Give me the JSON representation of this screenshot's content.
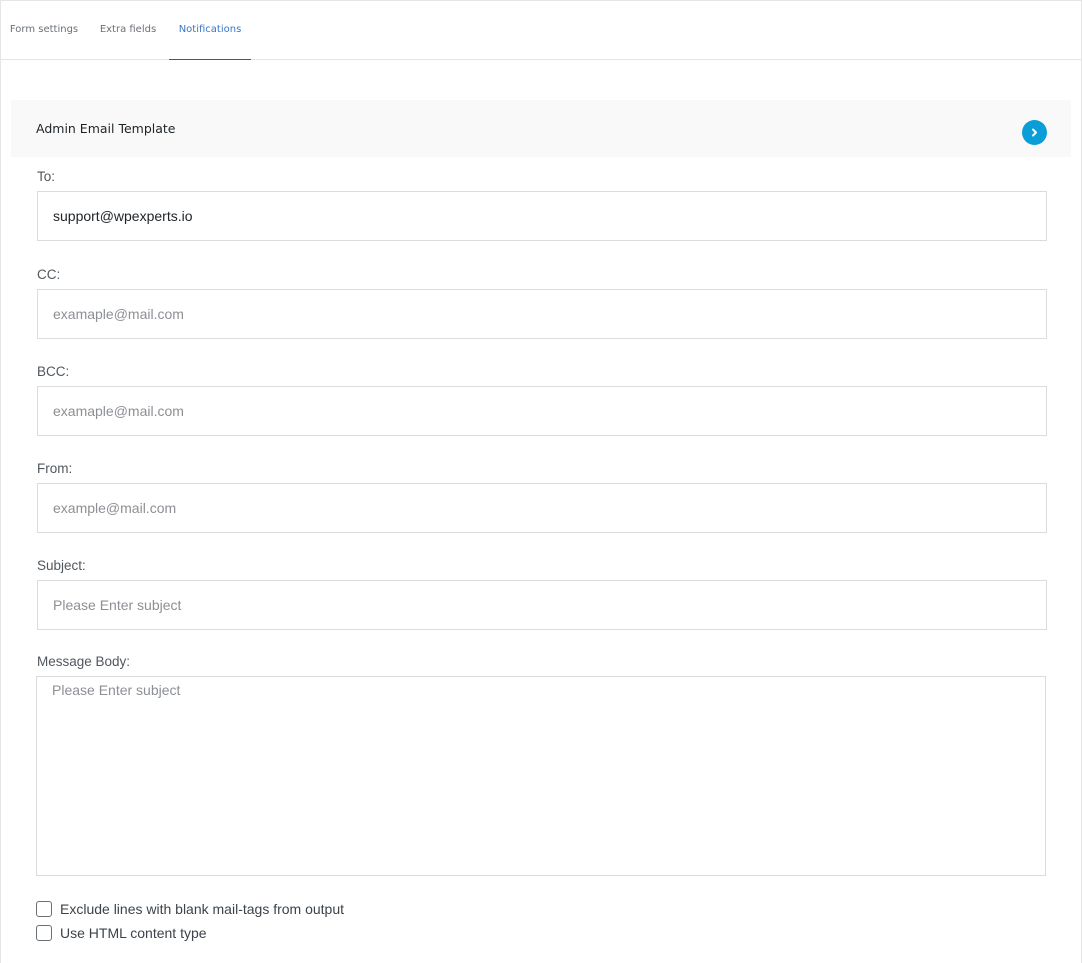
{
  "tabs": [
    {
      "label": "Form settings",
      "active": false
    },
    {
      "label": "Extra fields",
      "active": false
    },
    {
      "label": "Notifications",
      "active": true
    }
  ],
  "template": {
    "title": "Admin Email Template",
    "toggle_icon": "chevron-right-icon",
    "accent_color": "#0a9ed9"
  },
  "fields": {
    "to": {
      "label": "To:",
      "value": "support@wpexperts.io",
      "placeholder": ""
    },
    "cc": {
      "label": "CC:",
      "value": "",
      "placeholder": "examaple@mail.com"
    },
    "bcc": {
      "label": "BCC:",
      "value": "",
      "placeholder": "examaple@mail.com"
    },
    "from": {
      "label": "From:",
      "value": "",
      "placeholder": "example@mail.com"
    },
    "subject": {
      "label": "Subject:",
      "value": "",
      "placeholder": "Please Enter subject"
    },
    "body": {
      "label": "Message Body:",
      "value": "",
      "placeholder": "Please Enter subject"
    }
  },
  "options": {
    "exclude_blank": {
      "label": "Exclude lines with blank mail-tags from output",
      "checked": false
    },
    "html_content": {
      "label": "Use HTML content type",
      "checked": false
    }
  }
}
